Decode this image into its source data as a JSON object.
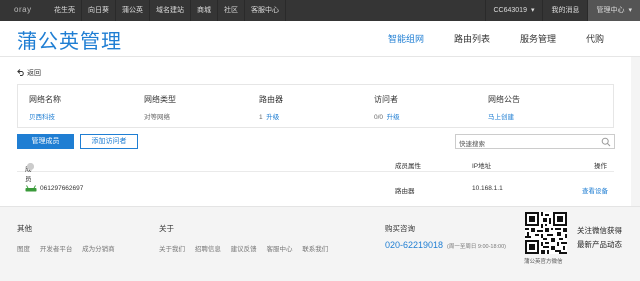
{
  "topbar": {
    "logo": "oray",
    "nav": [
      "花生壳",
      "向日葵",
      "蒲公英",
      "域名建站",
      "商城",
      "社区",
      "客服中心"
    ],
    "account": "CC643019",
    "messages": "我的消息",
    "admin": "管理中心"
  },
  "header": {
    "title": "蒲公英管理",
    "menu": [
      "智能组网",
      "路由列表",
      "服务管理",
      "代购"
    ]
  },
  "back_label": "返回",
  "info": {
    "network_name_label": "网络名称",
    "network_name_value": "贝西科技",
    "network_type_label": "网络类型",
    "network_type_value": "对等网络",
    "router_label": "路由器",
    "router_count": "1",
    "router_upgrade": "升级",
    "visitor_label": "访问者",
    "visitor_count": "0/0",
    "visitor_upgrade": "升级",
    "notice_label": "网络公告",
    "notice_action": "马上创建"
  },
  "toolbar": {
    "manage_members": "管理成员",
    "add_visitor": "添加访问者",
    "search_placeholder": "快速搜索"
  },
  "table": {
    "headers": [
      "成员",
      "成员属性",
      "IP地址",
      "操作"
    ],
    "rows": [
      {
        "member": "0612976626​97",
        "type": "路由器",
        "ip": "10.168.1.1",
        "action": "查看设备"
      }
    ]
  },
  "footer": {
    "col1_title": "其他",
    "col1_links": [
      "图度",
      "开发者平台",
      "成为分销商"
    ],
    "col2_title": "关于",
    "col2_links": [
      "关于我们",
      "招聘信息",
      "建议反馈",
      "客服中心",
      "联系我们"
    ],
    "col3_title": "购买咨询",
    "phone": "020-62219018",
    "hours": "(周一至周日 9:00-18:00)",
    "qr_caption": "蒲公英官方微信",
    "wechat_line1": "关注微信获得",
    "wechat_line2": "最新产品动态"
  },
  "colors": {
    "brand_blue": "#1f7ed3",
    "topbar_bg": "#353535"
  }
}
